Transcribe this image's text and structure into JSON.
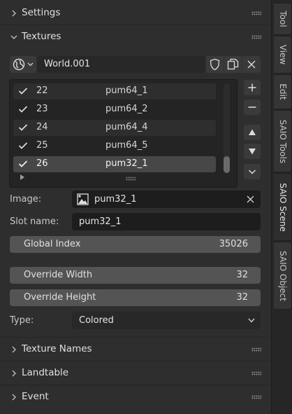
{
  "sections": {
    "settings": "Settings",
    "textures": "Textures",
    "texture_names": "Texture Names",
    "landtable": "Landtable",
    "event": "Event"
  },
  "world_selector": {
    "value": "World.001"
  },
  "texture_list": [
    {
      "index": "22",
      "name": "pum64_1",
      "checked": true
    },
    {
      "index": "23",
      "name": "pum64_2",
      "checked": true
    },
    {
      "index": "24",
      "name": "pum64_4",
      "checked": true
    },
    {
      "index": "25",
      "name": "pum64_5",
      "checked": true
    },
    {
      "index": "26",
      "name": "pum32_1",
      "checked": true,
      "selected": true
    }
  ],
  "image": {
    "label": "Image:",
    "value": "pum32_1"
  },
  "slot_name": {
    "label": "Slot name:",
    "value": "pum32_1"
  },
  "global_index": {
    "label": "Global Index",
    "value": "35026"
  },
  "override_width": {
    "label": "Override Width",
    "value": "32"
  },
  "override_height": {
    "label": "Override Height",
    "value": "32"
  },
  "type": {
    "label": "Type:",
    "value": "Colored"
  },
  "sidebar_tabs": [
    "Tool",
    "View",
    "Edit",
    "SAIO Tools",
    "SAIO Scene",
    "SAIO Object"
  ],
  "active_tab": "SAIO Scene"
}
